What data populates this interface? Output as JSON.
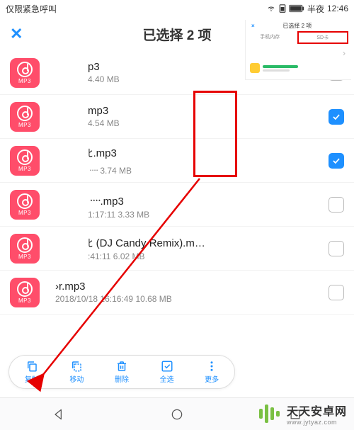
{
  "status": {
    "left": "仅限紧急呼叫",
    "time_prefix": "半夜",
    "time": "12:46"
  },
  "header": {
    "title": "已选择 2 项"
  },
  "files": [
    {
      "name": "p3",
      "meta": "4.40 MB",
      "checked": false
    },
    {
      "name": "mp3",
      "meta": "4.54 MB",
      "checked": true
    },
    {
      "name": "ﾋ.mp3",
      "meta": "᠁ 3.74 MB",
      "checked": true
    },
    {
      "name": "᠁.mp3",
      "meta": "1:17:11 3.33 MB",
      "checked": false
    },
    {
      "name": "ﾋ (DJ Candy Remix).m…",
      "meta": ":41:11 6.02 MB",
      "checked": false
    },
    {
      "name": "›r.mp3",
      "meta": "2018/10/18 16:16:49 10.68 MB",
      "checked": false,
      "wide": true
    }
  ],
  "bottom": {
    "items": [
      {
        "id": "copy",
        "label": "复制"
      },
      {
        "id": "move",
        "label": "移动"
      },
      {
        "id": "delete",
        "label": "删除"
      },
      {
        "id": "select-all",
        "label": "全选"
      },
      {
        "id": "more",
        "label": "更多"
      }
    ]
  },
  "inset": {
    "close": "×",
    "title": "已选择 2 项",
    "tab_left": "手机内存",
    "tab_right": "SD卡"
  },
  "brand": {
    "name": "天天安卓网",
    "url": "www.jytyaz.com"
  },
  "icon_label": "MP3"
}
